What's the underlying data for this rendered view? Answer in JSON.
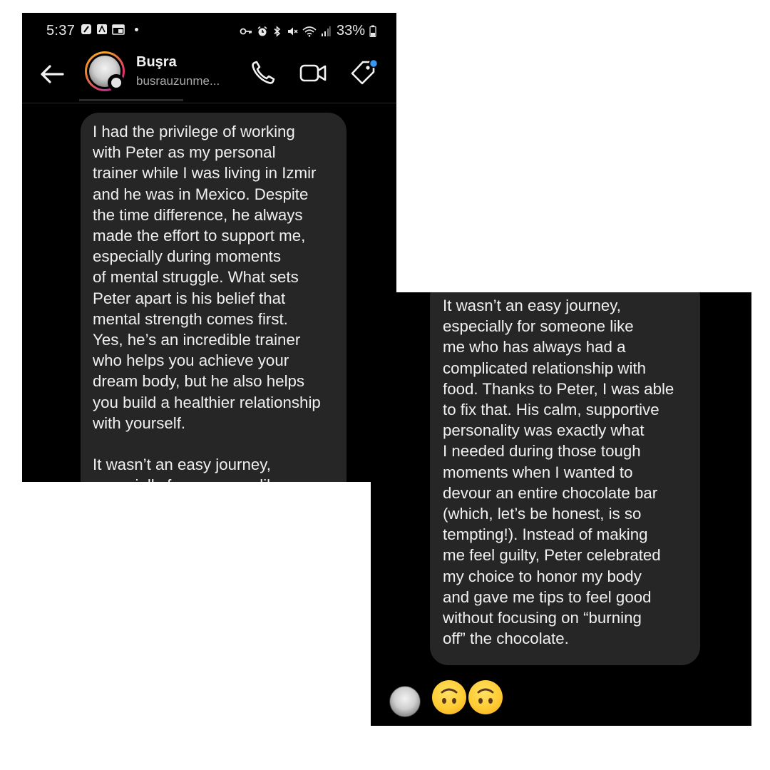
{
  "status_bar": {
    "time": "5:37",
    "battery": "33%",
    "left_icons": [
      "app-icon-1",
      "app-icon-2",
      "calendar-icon",
      "notification-dot"
    ],
    "right_icons": [
      "key-icon",
      "alarm-icon",
      "bluetooth-icon",
      "mute-icon",
      "wifi-icon",
      "signal-icon",
      "battery-icon"
    ]
  },
  "header": {
    "contact_name": "Buşra",
    "contact_username": "busrauzunme...",
    "icons": [
      "back-arrow-icon",
      "phone-icon",
      "video-camera-icon",
      "tag-icon"
    ],
    "accent_color": "#3897f0"
  },
  "messages": {
    "first": {
      "text": "I had the privilege of working\nwith Peter as my personal\ntrainer while I was living in Izmir\nand he was in Mexico. Despite\nthe time difference, he always\nmade the effort to support me,\nespecially during moments\nof mental struggle. What sets\nPeter apart is his belief that\nmental strength comes first.\nYes, he’s an incredible trainer\nwho helps you achieve your\ndream body, but he also helps\nyou build a healthier relationship\nwith yourself.\n\nIt wasn’t an easy journey,\nespecially for someone like"
    },
    "second": {
      "text": "It wasn’t an easy journey,\nespecially for someone like\nme who has always had a\ncomplicated relationship with\nfood. Thanks to Peter, I was able\nto fix that. His calm, supportive\npersonality was exactly what\nI needed during those tough\nmoments when I wanted to\ndevour an entire chocolate bar\n(which, let’s be honest, is so\ntempting!). Instead of making\nme feel guilty, Peter celebrated\nmy choice to honor my body\nand gave me tips to feel good\nwithout focusing on “burning\noff” the chocolate."
    }
  },
  "reply": {
    "emojis": [
      "upside-down-face",
      "upside-down-face"
    ]
  },
  "colors": {
    "background": "#000000",
    "bubble": "#262626",
    "text": "#f0f0f0",
    "secondary_text": "#a8a8a8"
  }
}
